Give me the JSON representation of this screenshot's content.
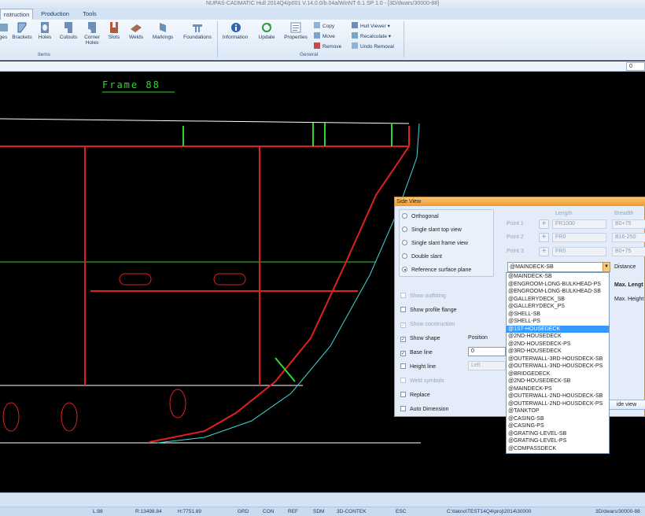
{
  "window": {
    "title": "NUPAS-CADMATIC Hull 2014Q4/p001 V.14.0.0/b.04a/WinNT 6.1 SP 1.0 - [3D/dwars/30000-88]"
  },
  "ribbon": {
    "tabs": [
      "nstruction",
      "Production",
      "Tools"
    ],
    "items_group": {
      "label": "Items",
      "buttons": [
        "ges",
        "Brackets",
        "Holes",
        "Cutouts",
        "Corner Holes",
        "Slots",
        "Welds",
        "Markings",
        "Foundations"
      ]
    },
    "general_group": {
      "label": "General",
      "buttons": [
        "Information",
        "Update",
        "Properties"
      ],
      "small_left": [
        "Copy",
        "Move",
        "Remove"
      ],
      "small_right": [
        "Hull Viewer",
        "Recalculate",
        "Undo Removal"
      ]
    }
  },
  "command_bar": {
    "value": "0"
  },
  "canvas": {
    "frame_label": "Frame 88"
  },
  "dialog": {
    "title": "Side View",
    "view_options": [
      {
        "label": "Orthogonal",
        "selected": false
      },
      {
        "label": "Single slant top view",
        "selected": false
      },
      {
        "label": "Single slant frame view",
        "selected": false
      },
      {
        "label": "Double slant",
        "selected": false
      },
      {
        "label": "Reference surface plane",
        "selected": true
      }
    ],
    "headers": {
      "length": "Length",
      "breadth": "Breadth"
    },
    "points": [
      {
        "label": "Point 1",
        "length": "FR1000",
        "breadth": "B0+75"
      },
      {
        "label": "Point 2",
        "length": "FR0",
        "breadth": "B16-250"
      },
      {
        "label": "Point 3",
        "length": "FR0",
        "breadth": "B0+75"
      }
    ],
    "reference_plane": "@MAINDECK-SB",
    "distance_label": "Distance",
    "max_length_label": "Max. Lengt",
    "max_height_label": "Max. Height",
    "checkboxes": [
      {
        "label": "Show outfitting",
        "checked": false,
        "enabled": false
      },
      {
        "label": "Show profile flange",
        "checked": false,
        "enabled": true
      },
      {
        "label": "Show construction",
        "checked": true,
        "enabled": false
      },
      {
        "label": "Show shape",
        "checked": true,
        "enabled": true
      },
      {
        "label": "Base line",
        "checked": true,
        "enabled": true
      },
      {
        "label": "Height line",
        "checked": false,
        "enabled": true
      },
      {
        "label": "Weld symbols",
        "checked": false,
        "enabled": false
      },
      {
        "label": "Replace",
        "checked": false,
        "enabled": true
      },
      {
        "label": "Auto Dimension",
        "checked": false,
        "enabled": true
      }
    ],
    "position_label": "Position",
    "position_value": "0",
    "height_line_value": "Left",
    "side_view_button": "ide view"
  },
  "dropdown": {
    "items": [
      "@MAINDECK-SB",
      "@ENGROOM-LONG-BULKHEAD-PS",
      "@ENGROOM-LONG-BULKHEAD-SB",
      "@GALLERYDECK_SB",
      "@GALLERYDECK_PS",
      "@SHELL-SB",
      "@SHELL-PS",
      "@1ST-HOUSEDECK",
      "@2ND-HOUSEDECK",
      "@2ND-HOUSEDECK-PS",
      "@3RD-HOUSEDECK",
      "@OUTERWALL-3RD-HOUSDECK-SB",
      "@OUTERWALL-3ND-HOUSDECK-PS",
      "@BRIDGEDECK",
      "@2ND-HOUSEDECK-SB",
      "@MAINDECK-PS",
      "@OUTERWALL-2ND-HOUSDECK-SB",
      "@OUTERWALL-2ND-HOUSDECK-PS",
      "@TANKTOP",
      "@CASING-SB",
      "@CASING-PS",
      "@GRATING-LEVEL-SB",
      "@GRATING-LEVEL-PS",
      "@COMPASSDECK"
    ],
    "selected": "@1ST-HOUSEDECK"
  },
  "status_bar": {
    "fields": [
      "L:88",
      "R:13498.84",
      "H:7751.89",
      "GRD",
      "CON",
      "REF",
      "SDM",
      "3D-CONTEK",
      "ESC",
      "C:\\takno\\TEST14Q4\\proj\\2014\\30000",
      "3D/dwars/30000-88"
    ]
  },
  "colors": {
    "dialog_title": "#ef9a2a",
    "selection": "#3399ff",
    "frame_label": "#2fd72f"
  }
}
